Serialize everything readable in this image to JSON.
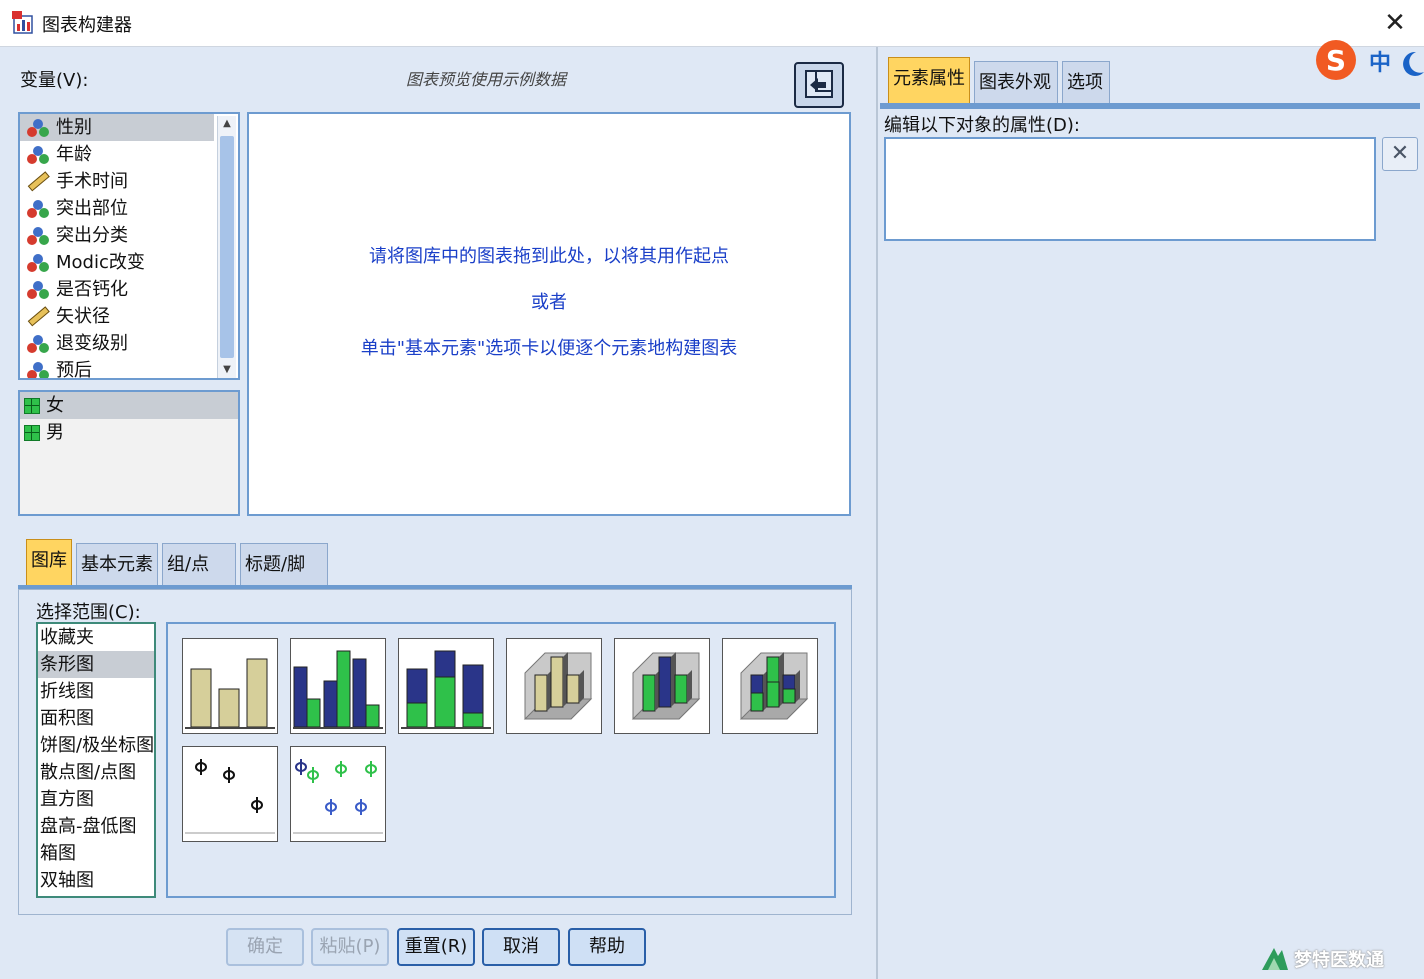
{
  "window": {
    "title": "图表构建器",
    "close_symbol": "✕"
  },
  "variables": {
    "label": "变量(V):",
    "items": [
      {
        "name": "性别",
        "type": "nominal"
      },
      {
        "name": "年龄",
        "type": "nominal"
      },
      {
        "name": "手术时间",
        "type": "scale"
      },
      {
        "name": "突出部位",
        "type": "nominal"
      },
      {
        "name": "突出分类",
        "type": "nominal"
      },
      {
        "name": "Modic改变",
        "type": "nominal"
      },
      {
        "name": "是否钙化",
        "type": "nominal"
      },
      {
        "name": "矢状径",
        "type": "scale"
      },
      {
        "name": "退变级别",
        "type": "nominal"
      },
      {
        "name": "预后",
        "type": "nominal"
      }
    ],
    "selected_index": 0
  },
  "categories": {
    "items": [
      "女",
      "男"
    ],
    "selected_index": 0
  },
  "preview": {
    "label": "图表预览使用示例数据",
    "hint_line1": "请将图库中的图表拖到此处，以将其用作起点",
    "hint_line2": "或者",
    "hint_line3": "单击\"基本元素\"选项卡以便逐个元素地构建图表"
  },
  "bottom_tabs": [
    {
      "label": "图库",
      "active": true
    },
    {
      "label": "基本元素",
      "active": false
    },
    {
      "label": "组/点 ID",
      "active": false
    },
    {
      "label": "标题/脚注",
      "active": false
    }
  ],
  "gallery": {
    "range_label": "选择范围(C):",
    "range_items": [
      "收藏夹",
      "条形图",
      "折线图",
      "面积图",
      "饼图/极坐标图",
      "散点图/点图",
      "直方图",
      "盘高-盘低图",
      "箱图",
      "双轴图"
    ],
    "selected_index": 1,
    "thumbnails": [
      "simple-bar",
      "clustered-bar",
      "stacked-bar",
      "3d-simple-bar",
      "3d-clustered-bar",
      "3d-stacked-bar",
      "error-bar-simple",
      "error-bar-clustered"
    ]
  },
  "buttons": {
    "ok": "确定",
    "paste": "粘贴(P)",
    "reset": "重置(R)",
    "cancel": "取消",
    "help": "帮助"
  },
  "right_panel": {
    "tabs": [
      {
        "label": "元素属性",
        "active": true
      },
      {
        "label": "图表外观",
        "active": false
      },
      {
        "label": "选项",
        "active": false
      }
    ],
    "edit_label": "编辑以下对象的属性(D):",
    "delete_symbol": "✕"
  },
  "ime": {
    "logo": "S",
    "mode": "中"
  },
  "watermark": {
    "text": "梦特医数通"
  },
  "colors": {
    "accent_blue": "#6d9bd0",
    "active_tab": "#ffd561",
    "hint_text": "#1a3fc8",
    "bar_tan": "#d6cf9a",
    "bar_navy": "#2a3589",
    "bar_green": "#2fc14a"
  }
}
